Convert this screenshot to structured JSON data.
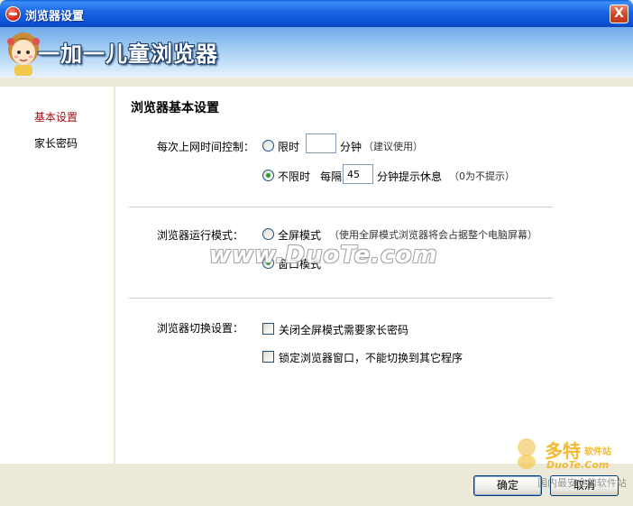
{
  "window": {
    "title": "浏览器设置",
    "close_glyph": "X"
  },
  "banner": {
    "title": "一加一儿童浏览器"
  },
  "sidebar": {
    "items": [
      {
        "label": "基本设置",
        "active": true
      },
      {
        "label": "家长密码",
        "active": false
      }
    ]
  },
  "main": {
    "section_title": "浏览器基本设置",
    "time_control": {
      "label": "每次上网时间控制：",
      "limited": {
        "label": "限时",
        "minutes_value": "",
        "unit": "分钟",
        "note": "（建议使用）",
        "checked": false
      },
      "unlimited": {
        "label": "不限时",
        "interval_prefix": "每隔",
        "interval_value": "45",
        "interval_suffix": "分钟提示休息",
        "note": "（0为不提示）",
        "checked": true
      }
    },
    "run_mode": {
      "label": "浏览器运行模式：",
      "fullscreen": {
        "label": "全屏模式",
        "note": "（使用全屏模式浏览器将会占据整个电脑屏幕）",
        "checked": false
      },
      "window": {
        "label": "窗口模式",
        "checked": true
      }
    },
    "switch_settings": {
      "label": "浏览器切换设置：",
      "option1": {
        "label": "关闭全屏模式需要家长密码",
        "checked": false
      },
      "option2": {
        "label": "锁定浏览器窗口，不能切换到其它程序",
        "checked": false
      }
    }
  },
  "watermark": {
    "center_text": "www.DuoTe.com",
    "brand_name": "多特",
    "brand_tag": "软件站",
    "brand_site": "DuoTe.Com",
    "brand_slogan": "国内最安全的软件站"
  },
  "buttons": {
    "ok_label": "确定",
    "cancel_label": "取消"
  },
  "colors": {
    "titlebar": "#0b4fd1",
    "active_item": "#a01010",
    "radio_dot": "#21a121"
  }
}
